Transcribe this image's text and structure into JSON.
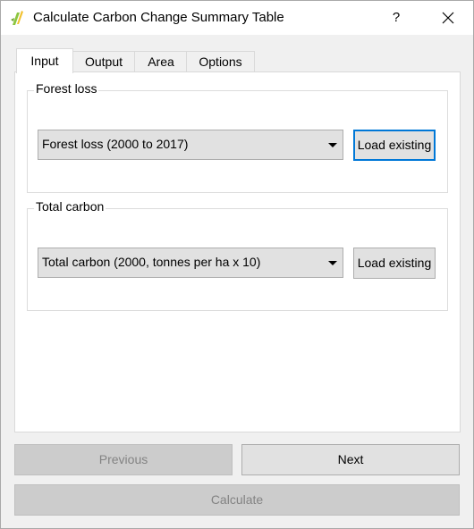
{
  "window": {
    "title": "Calculate Carbon Change Summary Table",
    "help_label": "?"
  },
  "tabs": [
    {
      "label": "Input"
    },
    {
      "label": "Output"
    },
    {
      "label": "Area"
    },
    {
      "label": "Options"
    }
  ],
  "active_tab": "Input",
  "forest_loss": {
    "group_title": "Forest loss",
    "selected": "Forest loss (2000 to 2017)",
    "load_label": "Load existing"
  },
  "total_carbon": {
    "group_title": "Total carbon",
    "selected": "Total carbon (2000, tonnes per ha x 10)",
    "load_label": "Load existing"
  },
  "buttons": {
    "previous": "Previous",
    "next": "Next",
    "calculate": "Calculate"
  },
  "colors": {
    "focus_accent": "#0078d7",
    "app_icon_green": "#8cc63f",
    "app_icon_yellow": "#f2c12e"
  },
  "icons": {
    "app": "qgis-plugin-icon",
    "close": "close-icon",
    "dropdown": "chevron-down-icon"
  }
}
